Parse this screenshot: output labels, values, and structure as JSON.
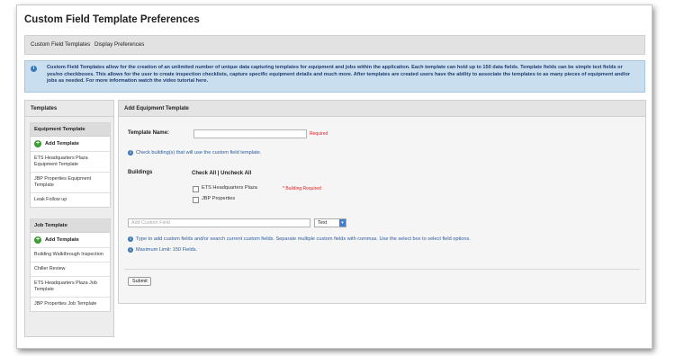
{
  "page": {
    "title": "Custom Field Template Preferences"
  },
  "tabs": [
    "Custom Field Templates",
    "Display Preferences"
  ],
  "info": {
    "text": "Custom Field Templates allow for the creation of an unlimited number of unique data capturing templates for equipment and jobs within the application. Each template can hold up to 150 data fields. Template fields can be simple text fields or yes/no checkboxes. This allows for the user to create inspection checklists, capture specific equipment details and much more. After templates are created users have the ability to associate the templates to as many pieces of equipment and/or jobs as needed. For more information watch the video tutorial here."
  },
  "sidebar": {
    "title": "Templates",
    "equipment": {
      "title": "Equipment Template",
      "add_label": "Add Template",
      "items": [
        "ETS Headquarters Plaza Equipment Template",
        "JBP Properties Equipment Template",
        "Leak Follow up"
      ]
    },
    "job": {
      "title": "Job Template",
      "add_label": "Add Template",
      "items": [
        "Building Walkthrough Inspection",
        "Chiller Review",
        "ETS Headquarters Plaza Job Template",
        "JBP Properties Job Template"
      ]
    }
  },
  "main": {
    "title": "Add Equipment Template",
    "template_name_label": "Template Name:",
    "template_name_value": "",
    "required_text": "Required",
    "check_hint": "Check building(s) that will use the custom field template.",
    "buildings_label": "Buildings",
    "check_all": "Check All | Uncheck All",
    "buildings": [
      "ETS Headquarters Plaza",
      "JBP Properties"
    ],
    "building_required": "* Building Required",
    "add_field_placeholder": "Add Custom Field",
    "field_type": "Text",
    "type_hint": "Type to add custom fields and/or search current custom fields. Separate multiple custom fields with commas. Use the select box to select field options.",
    "max_limit": "Maximum Limit: 150 Fields.",
    "submit_label": "Submit"
  }
}
